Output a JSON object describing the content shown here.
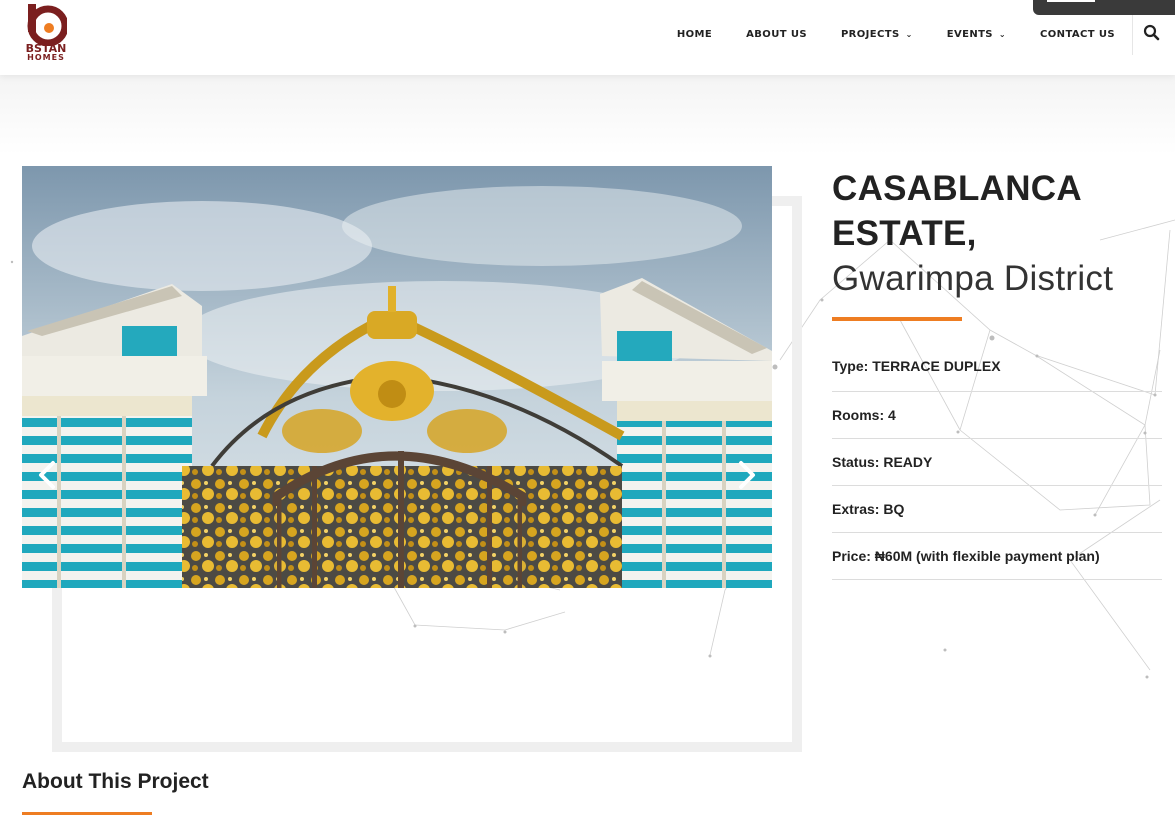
{
  "brand": {
    "name_line1": "BSTAN",
    "name_line2": "HOMES",
    "colors": {
      "maroon": "#7b1f1f",
      "orange": "#ee7d22"
    }
  },
  "nav": {
    "items": [
      {
        "label": "HOME",
        "has_dropdown": false
      },
      {
        "label": "ABOUT US",
        "has_dropdown": false
      },
      {
        "label": "PROJECTS",
        "has_dropdown": true
      },
      {
        "label": "EVENTS",
        "has_dropdown": true
      },
      {
        "label": "CONTACT US",
        "has_dropdown": false
      }
    ],
    "search_icon": "search-icon",
    "dropdown_icon": "chevron-down-icon"
  },
  "project": {
    "title_line1": "CASABLANCA",
    "title_line2": "ESTATE,",
    "location": "Gwarimpa District",
    "specs": [
      {
        "text": "Type: TERRACE DUPLEX"
      },
      {
        "text": "Rooms: 4"
      },
      {
        "text": "Status: READY"
      },
      {
        "text": "Extras: BQ"
      },
      {
        "text": "Price: ₦60M (with flexible payment plan)"
      }
    ]
  },
  "gallery": {
    "image_alt": "Ornate golden palace gate between blue and white columns",
    "prev_icon": "chevron-left-icon",
    "next_icon": "chevron-right-icon"
  },
  "about": {
    "heading": "About This Project"
  },
  "colors": {
    "accent": "#ee7d22",
    "divider": "#dcdcdc",
    "text": "#222222"
  }
}
